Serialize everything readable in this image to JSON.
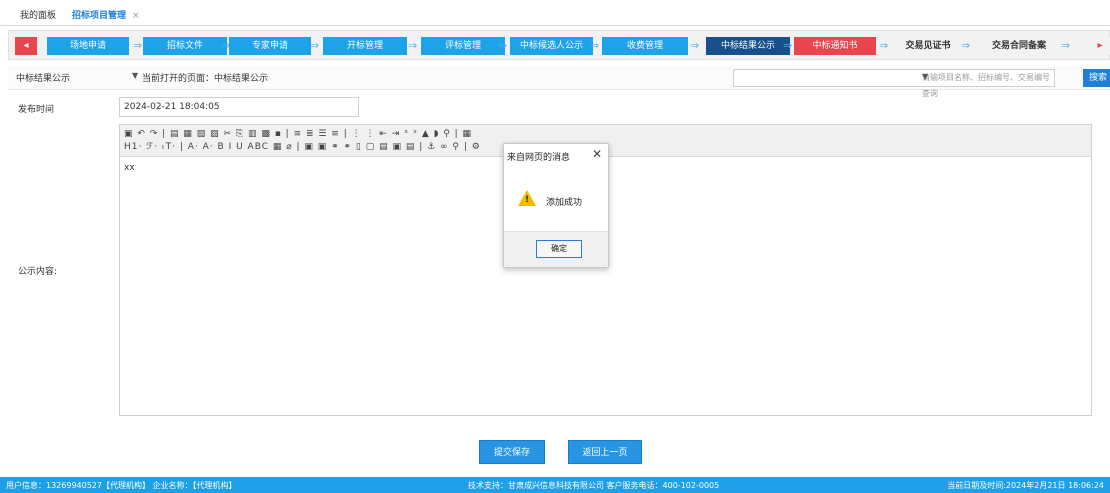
{
  "tabs": {
    "home": "我的面板",
    "active": "招标项目管理",
    "close": "×"
  },
  "workflow": {
    "prev": "◂",
    "next": "▸",
    "arrow": "⇒",
    "steps": [
      {
        "label": "场地申请"
      },
      {
        "label": "招标文件"
      },
      {
        "label": "专家申请"
      },
      {
        "label": "开标管理"
      },
      {
        "label": "评标管理"
      },
      {
        "label": "中标候选人公示"
      },
      {
        "label": "收费管理"
      },
      {
        "label": "中标结果公示"
      },
      {
        "label": "中标通知书"
      },
      {
        "label": "交易见证书"
      },
      {
        "label": "交易合同备案"
      }
    ]
  },
  "filter": {
    "selected": "中标结果公示",
    "dropdown_arrow": "▼",
    "current_page": "当前打开的页面：中标结果公示",
    "search_placeholder": "请输项目名称、招标编号、交易编号查询",
    "search_button": "搜索"
  },
  "form": {
    "publish_time_label": "发布时间",
    "publish_time_value": "2024-02-21 18:04:05",
    "content_label": "公示内容:",
    "content_value": "xx",
    "toolbar_row1": "▣ ↶ ↷ | ▤ ▦ ▧ ▨ ✂ ⎘ ▥ ▩ ▪ | ≡ ≣ ☰ ≡ | ⋮ ⋮ ⇤ ⇥ ˣ ˣ ▲ ◗ ⚲ | ▦",
    "toolbar_row2": "H1· ℱ· ₜT· | A· A· B I U ABC ▦ ⌀ | ▣ ▣ ⚭ ⚭ ▯ ▢ ▤ ▣ ▤ | ⚓ ∞ ⚲ | ⚙",
    "submit_button": "提交保存",
    "back_button": "返回上一页"
  },
  "footer": {
    "user_info": "用户信息：13269940527【代理机构】 企业名称：【代理机构】",
    "support": "技术支持：甘肃成兴信息科技有限公司 客户服务电话：400-102-0005",
    "datetime": "当前日期及时间:2024年2月21日 18:06:24"
  },
  "dialog": {
    "title": "来自网页的消息",
    "close": "✕",
    "message": "添加成功",
    "ok_button": "确定"
  },
  "colors": {
    "step_blue": "#1fa3e8",
    "step_current": "#174e8c",
    "step_red": "#e8454f",
    "footer_blue": "#1fa0e6",
    "warning_yellow": "#f5b800"
  }
}
